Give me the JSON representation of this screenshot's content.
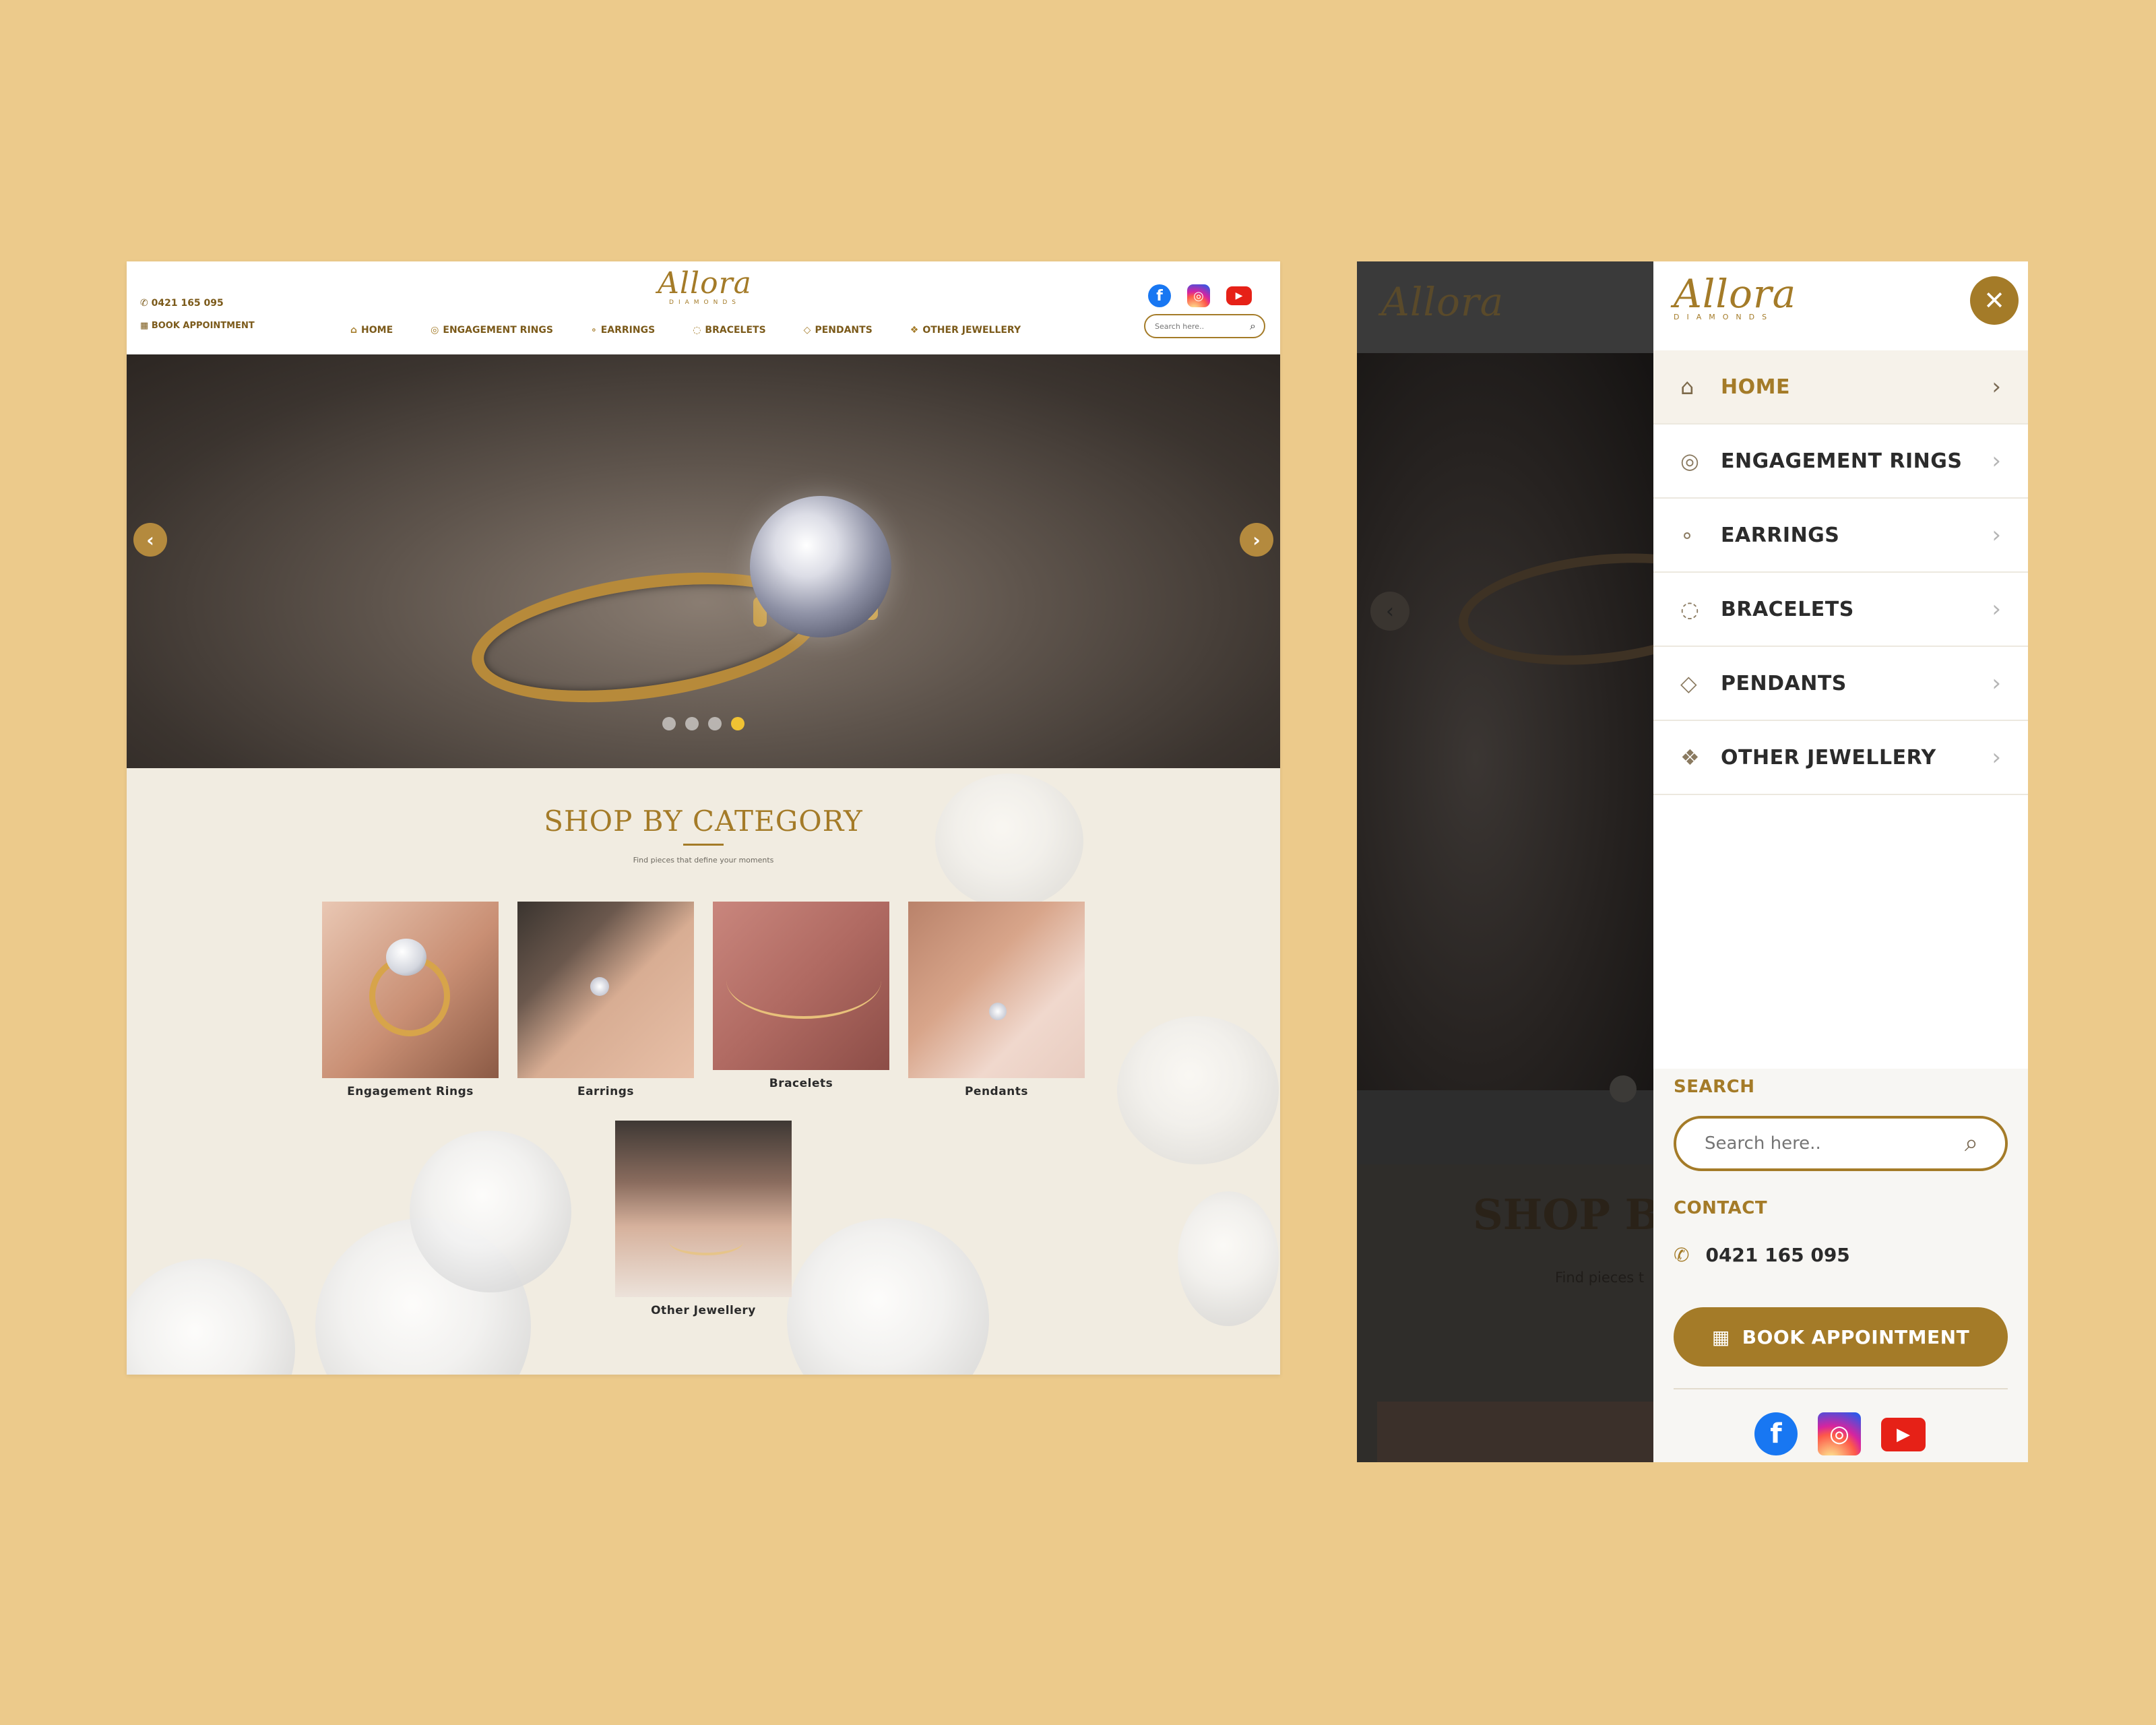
{
  "desktop": {
    "logo": {
      "word": "Allora",
      "sub": "DIAMONDS"
    },
    "phone": "0421 165 095",
    "book": "BOOK APPOINTMENT",
    "nav": [
      {
        "label": "HOME",
        "icon": "home-icon"
      },
      {
        "label": "ENGAGEMENT RINGS",
        "icon": "rings-icon"
      },
      {
        "label": "EARRINGS",
        "icon": "earrings-icon"
      },
      {
        "label": "BRACELETS",
        "icon": "bracelet-icon"
      },
      {
        "label": "PENDANTS",
        "icon": "pendant-icon"
      },
      {
        "label": "OTHER JEWELLERY",
        "icon": "jewellery-icon"
      }
    ],
    "search_placeholder": "Search here..",
    "hero": {
      "slides": 4,
      "active_slide": 4
    },
    "category": {
      "title": "SHOP BY CATEGORY",
      "subtitle": "Find pieces that define your moments",
      "items": [
        "Engagement Rings",
        "Earrings",
        "Bracelets",
        "Pendants",
        "Other Jewellery"
      ]
    }
  },
  "mobile": {
    "logo": {
      "word": "Allora",
      "sub": "DIAMONDS"
    },
    "menu": [
      {
        "label": "HOME",
        "icon": "home-icon",
        "active": true
      },
      {
        "label": "ENGAGEMENT RINGS",
        "icon": "rings-icon"
      },
      {
        "label": "EARRINGS",
        "icon": "earrings-icon"
      },
      {
        "label": "BRACELETS",
        "icon": "bracelet-icon"
      },
      {
        "label": "PENDANTS",
        "icon": "pendant-icon"
      },
      {
        "label": "OTHER JEWELLERY",
        "icon": "jewellery-icon"
      }
    ],
    "search_heading": "SEARCH",
    "search_placeholder": "Search here..",
    "contact_heading": "CONTACT",
    "phone": "0421 165 095",
    "book": "BOOK APPOINTMENT",
    "bg_hint": {
      "title": "SHOP BY",
      "subtitle": "Find pieces t"
    }
  },
  "colors": {
    "background": "#ecca8b",
    "gold": "#a47b28",
    "panel": "#ffffff"
  }
}
